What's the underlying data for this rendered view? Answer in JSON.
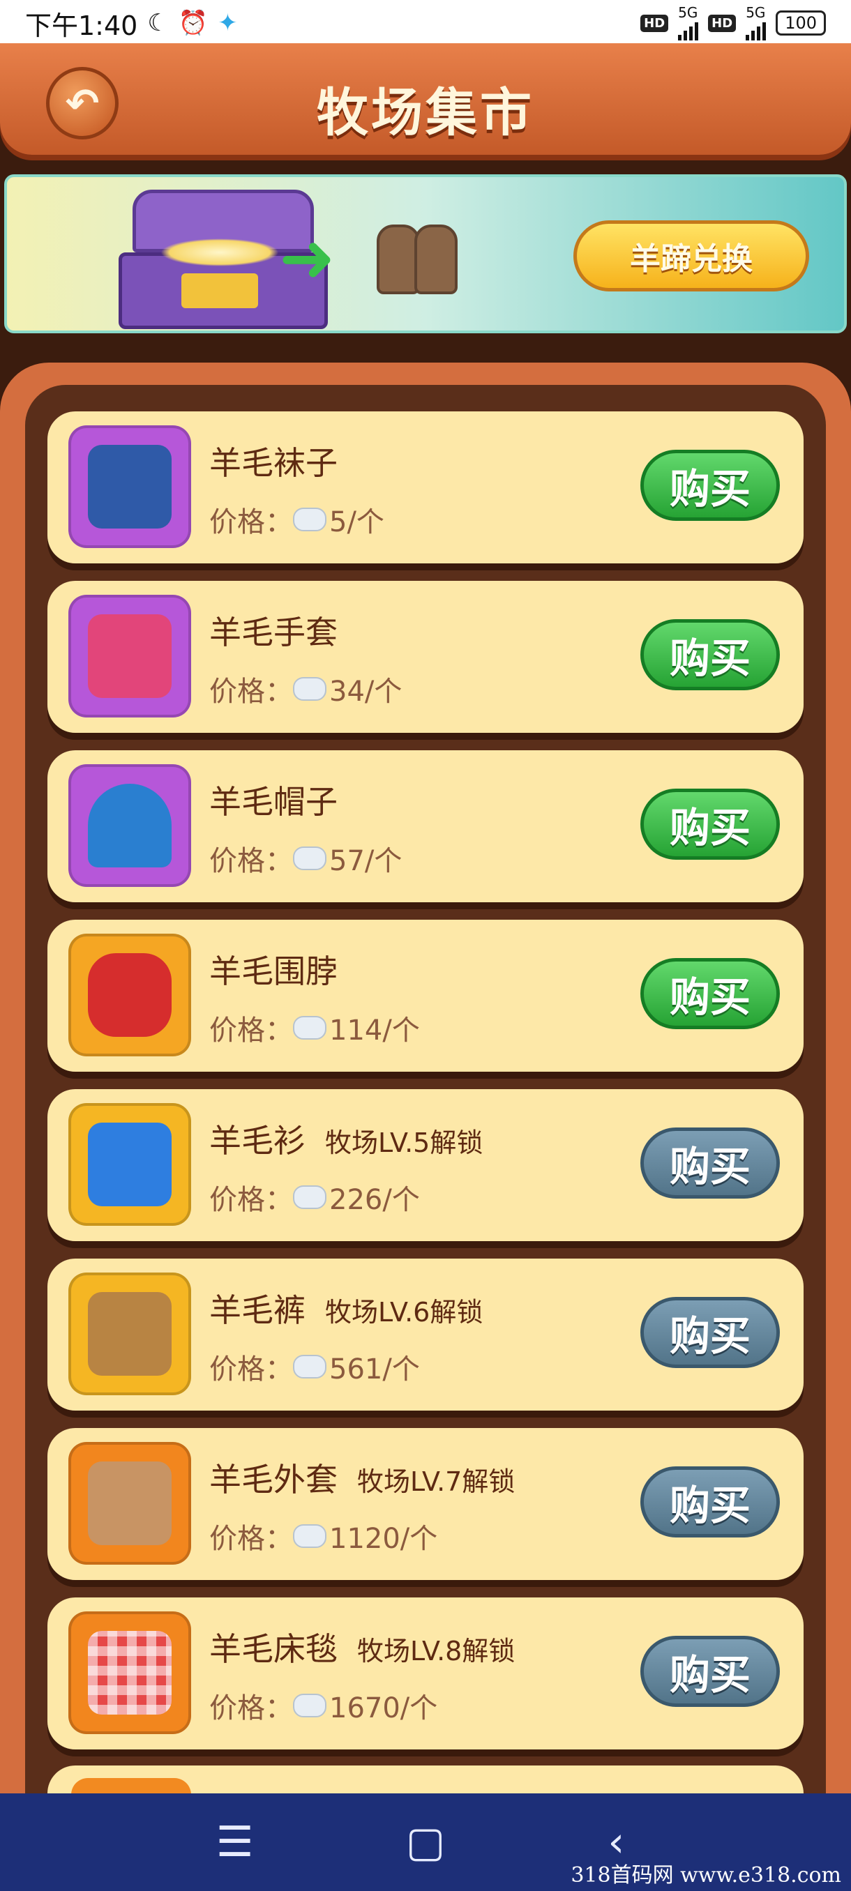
{
  "status_bar": {
    "time": "下午1:40",
    "hd1": "HD",
    "net1": "5G",
    "hd2": "HD",
    "net2": "5G",
    "battery": "100"
  },
  "header": {
    "title": "牧场集市"
  },
  "banner": {
    "button_label": "羊蹄兑换"
  },
  "items": [
    {
      "name": "羊毛袜子",
      "price_label": "价格：",
      "price": "5/个",
      "buy_label": "购买",
      "unlock": "",
      "state": "active",
      "icon": "wool-sock-icon",
      "icon_bg": "#b657d9"
    },
    {
      "name": "羊毛手套",
      "price_label": "价格：",
      "price": "34/个",
      "buy_label": "购买",
      "unlock": "",
      "state": "active",
      "icon": "wool-glove-icon",
      "icon_bg": "#b657d9"
    },
    {
      "name": "羊毛帽子",
      "price_label": "价格：",
      "price": "57/个",
      "buy_label": "购买",
      "unlock": "",
      "state": "active",
      "icon": "wool-hat-icon",
      "icon_bg": "#b657d9"
    },
    {
      "name": "羊毛围脖",
      "price_label": "价格：",
      "price": "114/个",
      "buy_label": "购买",
      "unlock": "",
      "state": "active",
      "icon": "wool-scarf-icon",
      "icon_bg": "#f5a623"
    },
    {
      "name": "羊毛衫",
      "price_label": "价格：",
      "price": "226/个",
      "buy_label": "购买",
      "unlock": "牧场LV.5解锁",
      "state": "locked",
      "icon": "wool-sweater-icon",
      "icon_bg": "#f5b623"
    },
    {
      "name": "羊毛裤",
      "price_label": "价格：",
      "price": "561/个",
      "buy_label": "购买",
      "unlock": "牧场LV.6解锁",
      "state": "locked",
      "icon": "wool-pants-icon",
      "icon_bg": "#f5b623"
    },
    {
      "name": "羊毛外套",
      "price_label": "价格：",
      "price": "1120/个",
      "buy_label": "购买",
      "unlock": "牧场LV.7解锁",
      "state": "locked",
      "icon": "wool-coat-icon",
      "icon_bg": "#f2861e"
    },
    {
      "name": "羊毛床毯",
      "price_label": "价格：",
      "price": "1670/个",
      "buy_label": "购买",
      "unlock": "牧场LV.8解锁",
      "state": "locked",
      "icon": "wool-blanket-icon",
      "icon_bg": "#f2861e"
    }
  ],
  "icon_colors": {
    "wool-sock-icon": "#2f5aa8",
    "wool-glove-icon": "#e2457a",
    "wool-hat-icon": "#2a7fd0",
    "wool-scarf-icon": "#d62d2d",
    "wool-sweater-icon": "#2e7ee0",
    "wool-pants-icon": "#b88443",
    "wool-coat-icon": "#c89464",
    "wool-blanket-icon": "#e64848"
  },
  "watermark": "318首码网  www.e318.com"
}
